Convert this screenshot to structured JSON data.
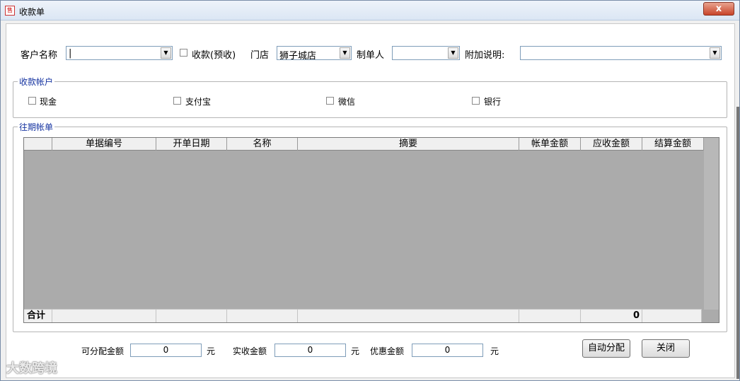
{
  "window": {
    "title": "收款单",
    "app_icon_text": "售",
    "close_symbol": "x"
  },
  "filters": {
    "customer_label": "客户名称",
    "customer_value": "|",
    "prepay_label": "收款(预收)",
    "store_label": "门店",
    "store_value": "狮子城店",
    "creator_label": "制单人",
    "creator_value": "",
    "note_label": "附加说明:",
    "note_value": ""
  },
  "payment_accounts": {
    "title": "收款帐户",
    "options": [
      "现金",
      "支付宝",
      "微信",
      "银行"
    ]
  },
  "bills": {
    "title": "往期帐单",
    "columns": [
      "",
      "单据编号",
      "开单日期",
      "名称",
      "摘要",
      "帐单金额",
      "应收金额",
      "结算金额"
    ],
    "rows": [],
    "footer": {
      "label": "合计",
      "receivable_total": "0"
    }
  },
  "amounts": {
    "distributable_label": "可分配金额",
    "distributable_value": "0",
    "received_label": "实收金额",
    "received_value": "0",
    "discount_label": "优惠金额",
    "discount_value": "0",
    "unit": "元"
  },
  "actions": {
    "auto_allocate": "自动分配",
    "close": "关闭"
  },
  "watermark": "大数跨境",
  "colors": {
    "group_title": "#1533a0",
    "grid_background": "#ababab",
    "close_button": "#c8442a"
  }
}
